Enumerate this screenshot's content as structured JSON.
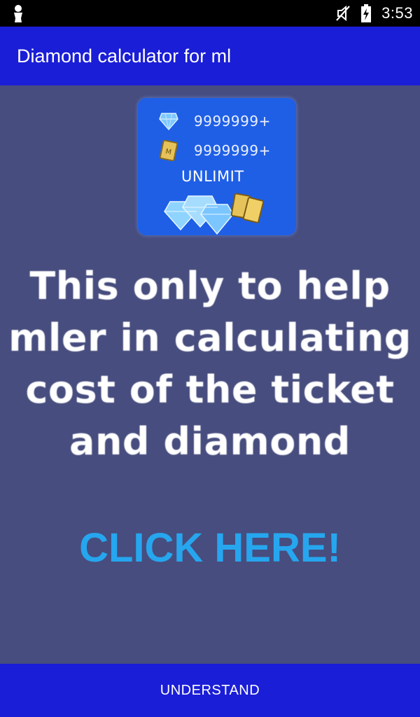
{
  "status_bar": {
    "time": "3:53",
    "icons": [
      "notification-figure-icon",
      "mute-icon",
      "battery-charging-icon"
    ]
  },
  "app_bar": {
    "title": "Diamond calculator for ml"
  },
  "banner": {
    "rows": [
      {
        "icon": "diamond-icon",
        "amount": "9999999+"
      },
      {
        "icon": "ticket-icon",
        "amount": "9999999+"
      }
    ],
    "unlimit_label": "UNLIMIT"
  },
  "message": {
    "line1": "This only to help",
    "line2": "mler in calculating",
    "line3": "cost of the ticket",
    "line4": "and diamond"
  },
  "cta": {
    "label": "CLICK HERE!"
  },
  "bottom_button": {
    "label": "UNDERSTAND"
  },
  "colors": {
    "background": "#474d7e",
    "app_bar": "#1a1ed6",
    "banner": "#1f5fe6",
    "cta_text": "#26a6ef",
    "status_bar": "#000000"
  }
}
